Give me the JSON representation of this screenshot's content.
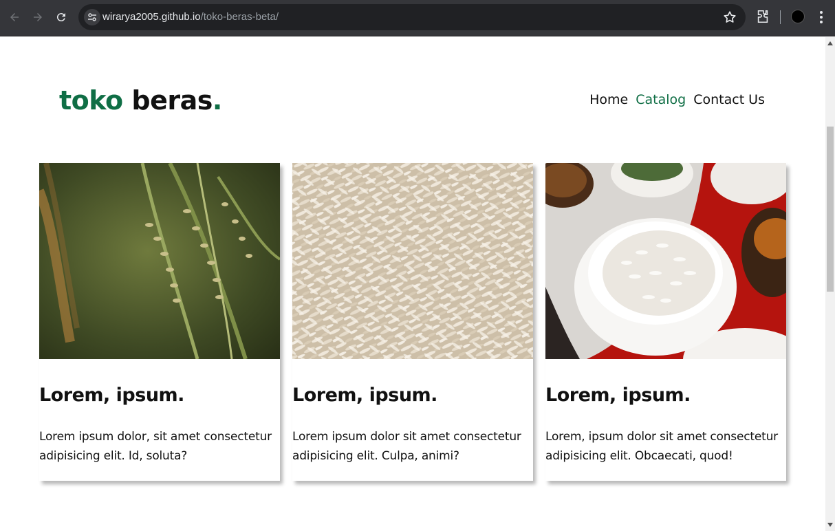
{
  "browser": {
    "url_host": "wirarya2005.github.io",
    "url_path": "/toko-beras-beta/",
    "icons": [
      "back-arrow-icon",
      "forward-arrow-icon",
      "reload-icon",
      "site-settings-icon",
      "bookmark-star-icon",
      "extensions-icon",
      "profile-avatar-icon",
      "chrome-menu-icon"
    ]
  },
  "header": {
    "logo_part1": "toko",
    "logo_part2": "beras",
    "logo_dot": ".",
    "brand_color": "#0f6e45"
  },
  "nav": {
    "items": [
      {
        "label": "Home",
        "active": false
      },
      {
        "label": "Catalog",
        "active": true
      },
      {
        "label": "Contact Us",
        "active": false
      }
    ]
  },
  "cards": [
    {
      "image": "rice-plant-photo",
      "title": "Lorem, ipsum.",
      "text": "Lorem ipsum dolor, sit amet consectetur adipisicing elit. Id, soluta?"
    },
    {
      "image": "raw-rice-grains-photo",
      "title": "Lorem, ipsum.",
      "text": "Lorem ipsum dolor sit amet consectetur adipisicing elit. Culpa, animi?"
    },
    {
      "image": "cooked-rice-bowl-photo",
      "title": "Lorem, ipsum.",
      "text": "Lorem, ipsum dolor sit amet consectetur adipisicing elit. Obcaecati, quod!"
    }
  ]
}
